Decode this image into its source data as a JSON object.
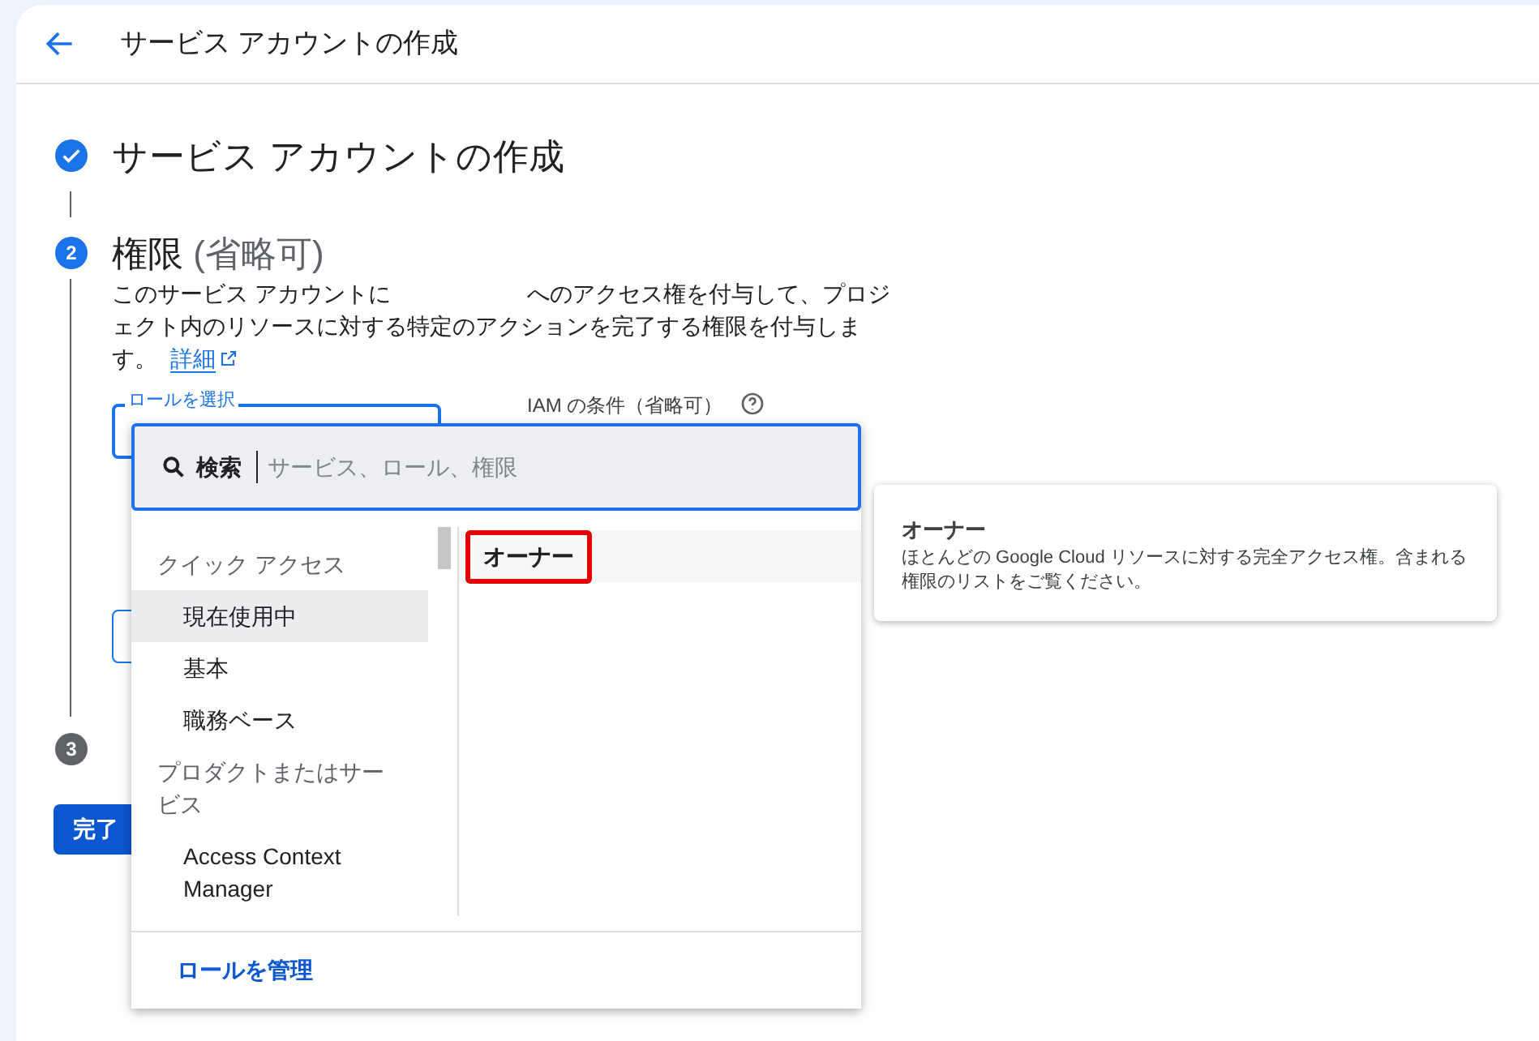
{
  "header": {
    "title": "サービス アカウントの作成"
  },
  "steps": [
    {
      "kind": "done",
      "title": "サービス アカウントの作成"
    },
    {
      "kind": "active",
      "number": "2",
      "title": "権限",
      "title_note": "(省略可)",
      "description_start": "このサービス アカウントに",
      "description_end": "へのアクセス権を付与して、プロジェクト内のリソースに対する特定のアクションを完了する権限を付与します。",
      "link": "詳細"
    },
    {
      "kind": "pending",
      "number": "3"
    }
  ],
  "role_field": {
    "label": "ロールを選択"
  },
  "condition_field": {
    "label": "IAM の条件（省略可）"
  },
  "done_button": "完了",
  "role_picker": {
    "search_label": "検索",
    "search_placeholder": "サービス、ロール、権限",
    "groups": [
      {
        "label": "クイック アクセス",
        "items": [
          {
            "label": "現在使用中",
            "selected": true
          },
          {
            "label": "基本",
            "selected": false
          },
          {
            "label": "職務ベース",
            "selected": false
          }
        ]
      },
      {
        "label": "プロダクトまたはサービス",
        "items": [
          {
            "label": "Access Context Manager",
            "selected": false
          }
        ]
      }
    ],
    "roles": [
      {
        "label": "オーナー",
        "outlined": true
      }
    ],
    "manage_link": "ロールを管理"
  },
  "tooltip": {
    "title": "オーナー",
    "description": "ほとんどの Google Cloud リソースに対する完全アクセス権。含まれる権限のリストをご覧ください。"
  }
}
